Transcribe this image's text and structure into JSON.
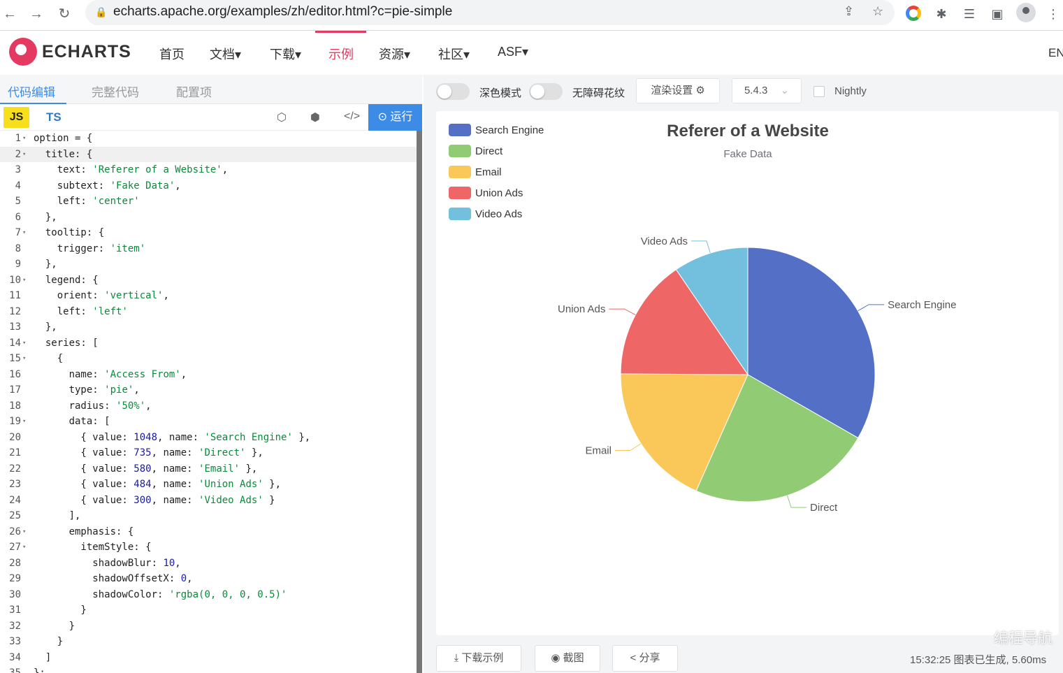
{
  "browser": {
    "url": "echarts.apache.org/examples/zh/editor.html?c=pie-simple"
  },
  "header": {
    "logo_text": "ECHARTS",
    "menu": [
      {
        "label": "首页"
      },
      {
        "label": "文档▾"
      },
      {
        "label": "下载▾"
      },
      {
        "label": "示例"
      },
      {
        "label": "资源▾"
      },
      {
        "label": "社区▾"
      },
      {
        "label": "ASF▾"
      }
    ],
    "lang": "EN"
  },
  "editor": {
    "tabs": [
      "代码编辑",
      "完整代码",
      "配置项"
    ],
    "js_label": "JS",
    "ts_label": "TS",
    "run_label": "运行",
    "lines": [
      "option = {",
      "  title: {",
      "    text: 'Referer of a Website',",
      "    subtext: 'Fake Data',",
      "    left: 'center'",
      "  },",
      "  tooltip: {",
      "    trigger: 'item'",
      "  },",
      "  legend: {",
      "    orient: 'vertical',",
      "    left: 'left'",
      "  },",
      "  series: [",
      "    {",
      "      name: 'Access From',",
      "      type: 'pie',",
      "      radius: '50%',",
      "      data: [",
      "        { value: 1048, name: 'Search Engine' },",
      "        { value: 735, name: 'Direct' },",
      "        { value: 580, name: 'Email' },",
      "        { value: 484, name: 'Union Ads' },",
      "        { value: 300, name: 'Video Ads' }",
      "      ],",
      "      emphasis: {",
      "        itemStyle: {",
      "          shadowBlur: 10,",
      "          shadowOffsetX: 0,",
      "          shadowColor: 'rgba(0, 0, 0, 0.5)'",
      "        }",
      "      }",
      "    }",
      "  ]",
      "};"
    ]
  },
  "controls": {
    "dark_mode_label": "深色模式",
    "accessibility_label": "无障碍花纹",
    "render_settings_label": "渲染设置 ⚙",
    "version": "5.4.3",
    "nightly_label": "Nightly"
  },
  "chart_data": {
    "type": "pie",
    "title": "Referer of a Website",
    "subtitle": "Fake Data",
    "legend_position": "top-left",
    "categories": [
      "Search Engine",
      "Direct",
      "Email",
      "Union Ads",
      "Video Ads"
    ],
    "values": [
      1048,
      735,
      580,
      484,
      300
    ],
    "colors": [
      "#5470c6",
      "#91cc75",
      "#fac858",
      "#ee6666",
      "#73c0de"
    ]
  },
  "footer": {
    "download_label": "下载示例",
    "screenshot_label": "截图",
    "share_label": "分享",
    "status": "15:32:25  图表已生成, 5.60ms",
    "watermark": "编程导航"
  }
}
